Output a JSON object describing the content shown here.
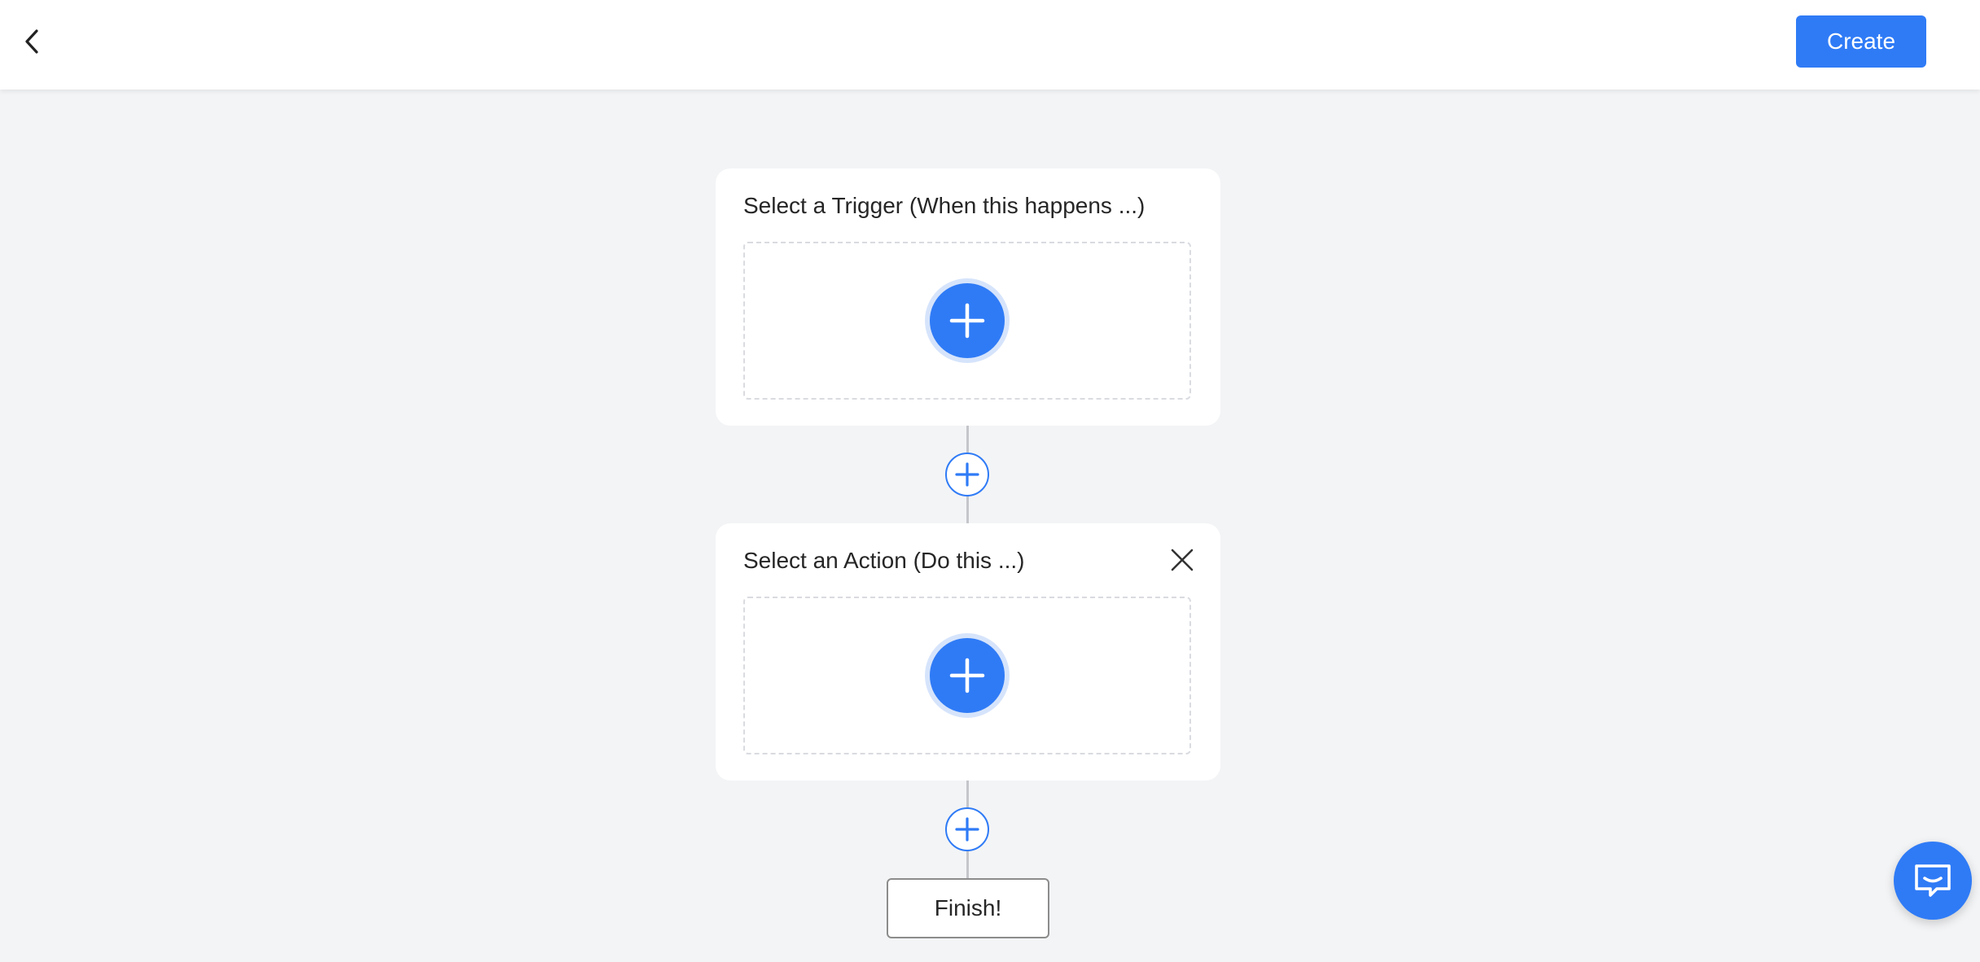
{
  "header": {
    "back_icon": "chevron-left-icon",
    "create_label": "Create",
    "accent_color": "#2f7bf6"
  },
  "trigger_card": {
    "title": "Select a Trigger (When this happens ...)",
    "add_icon": "plus-icon"
  },
  "action_card": {
    "title": "Select an Action (Do this ...)",
    "add_icon": "plus-icon",
    "close_icon": "close-icon"
  },
  "flow": {
    "insert_step_icon": "plus-icon",
    "finish_label": "Finish!"
  },
  "chat": {
    "icon": "chat-icon"
  }
}
